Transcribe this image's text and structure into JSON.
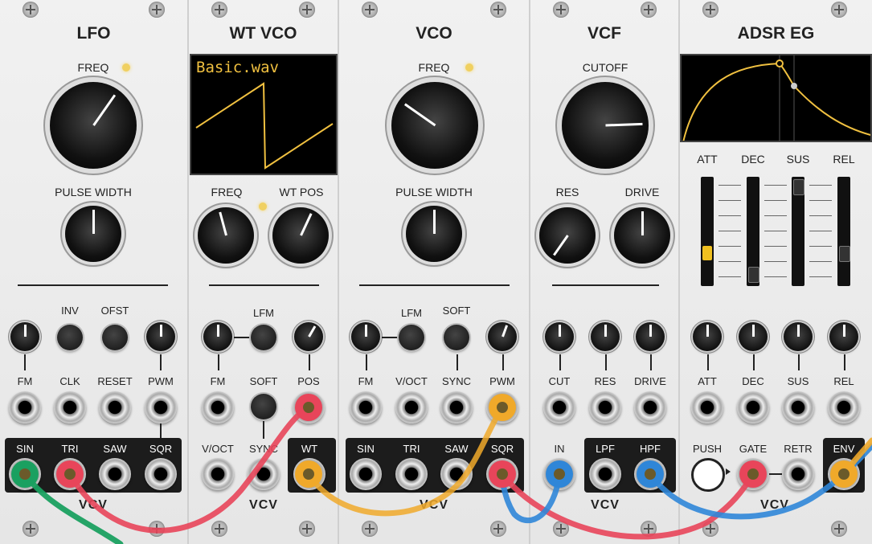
{
  "modules": {
    "lfo": {
      "title": "LFO",
      "freq_label": "FREQ",
      "pw_label": "PULSE WIDTH",
      "inv": "INV",
      "ofst": "OFST",
      "in_labels": [
        "FM",
        "CLK",
        "RESET",
        "PWM"
      ],
      "out_labels": [
        "SIN",
        "TRI",
        "SAW",
        "SQR"
      ]
    },
    "wtvco": {
      "title": "WT VCO",
      "display": "Basic.wav",
      "freq": "FREQ",
      "wtpos": "WT POS",
      "lfm": "LFM",
      "fm": "FM",
      "soft": "SOFT",
      "pos": "POS",
      "voct": "V/OCT",
      "sync": "SYNC",
      "wt": "WT"
    },
    "vco": {
      "title": "VCO",
      "freq": "FREQ",
      "pw": "PULSE WIDTH",
      "lfm": "LFM",
      "soft": "SOFT",
      "in_labels": [
        "FM",
        "V/OCT",
        "SYNC",
        "PWM"
      ],
      "out_labels": [
        "SIN",
        "TRI",
        "SAW",
        "SQR"
      ]
    },
    "vcf": {
      "title": "VCF",
      "cutoff": "CUTOFF",
      "res": "RES",
      "drive": "DRIVE",
      "mod_labels": [
        "CUT",
        "RES",
        "DRIVE"
      ],
      "in": "IN",
      "lpf": "LPF",
      "hpf": "HPF"
    },
    "adsr": {
      "title": "ADSR EG",
      "slider_labels": [
        "ATT",
        "DEC",
        "SUS",
        "REL"
      ],
      "mod_labels": [
        "ATT",
        "DEC",
        "SUS",
        "REL"
      ],
      "push": "PUSH",
      "gate": "GATE",
      "retr": "RETR",
      "env": "ENV"
    }
  },
  "brand": "VCV",
  "colors": {
    "cable_green": "#1aa060",
    "cable_red": "#e8455a",
    "cable_orange": "#f0a92a",
    "cable_blue": "#2f86d8",
    "display_trace": "#f0c040",
    "led": "#f0d060"
  },
  "icons": {
    "screw": "screw-icon",
    "jack": "jack-icon",
    "knob": "knob-icon",
    "led": "led-icon"
  }
}
